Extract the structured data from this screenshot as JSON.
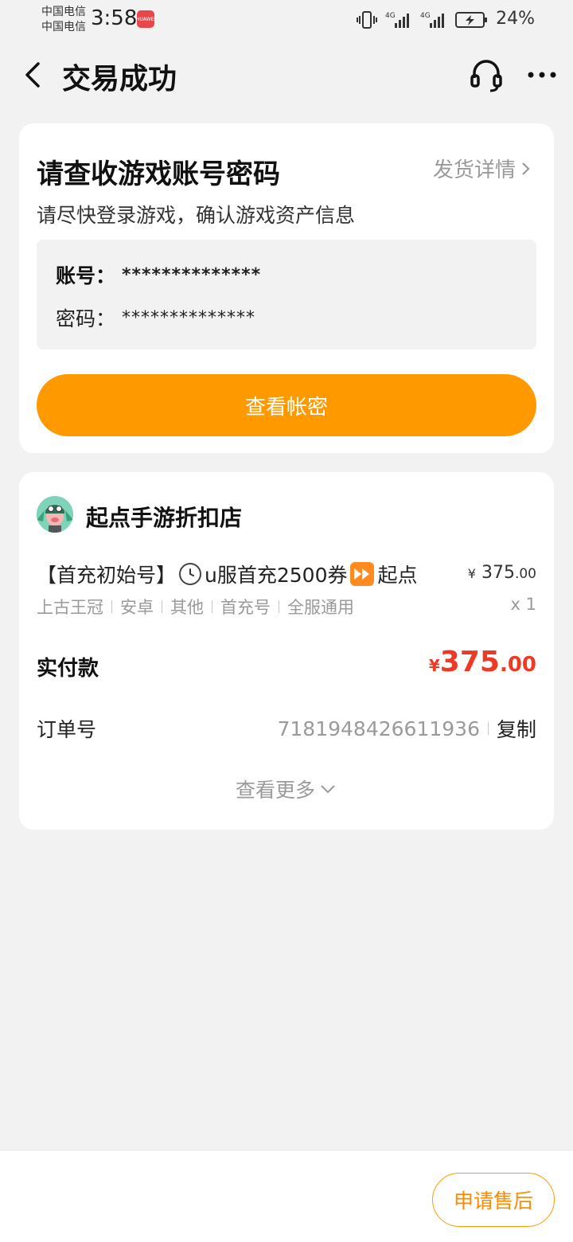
{
  "status_bar": {
    "carrier_1": "中国电信",
    "carrier_2": "中国电信",
    "time": "3:58",
    "app_badge": "HUAWEI",
    "net_1": "4G",
    "net_2": "4G",
    "battery": "24%"
  },
  "nav": {
    "title": "交易成功"
  },
  "account_card": {
    "title": "请查收游戏账号密码",
    "detail_link": "发货详情",
    "subtitle": "请尽快登录游戏，确认游戏资产信息",
    "account_label": "账号：",
    "account_value": "**************",
    "password_label": "密码：",
    "password_value": "**************",
    "view_button": "查看帐密"
  },
  "order_card": {
    "shop_name": "起点手游折扣店",
    "product": {
      "title_part1": "【首充初始号】",
      "title_part2": "u服首充2500券",
      "title_part3": "起点",
      "price_currency": "¥",
      "price_int": "375",
      "price_dec": ".00",
      "tags": [
        "上古王冠",
        "安卓",
        "其他",
        "首充号",
        "全服通用"
      ],
      "quantity": "x 1"
    },
    "paid_label": "实付款",
    "paid_currency": "¥",
    "paid_int": "375",
    "paid_dec": ".00",
    "order_label": "订单号",
    "order_number": "7181948426611936",
    "copy_label": "复制",
    "view_more": "查看更多"
  },
  "bottom": {
    "after_sale": "申请售后"
  },
  "colors": {
    "accent": "#ff9900",
    "price_red": "#ee3a24",
    "background": "#f2f2f2"
  }
}
